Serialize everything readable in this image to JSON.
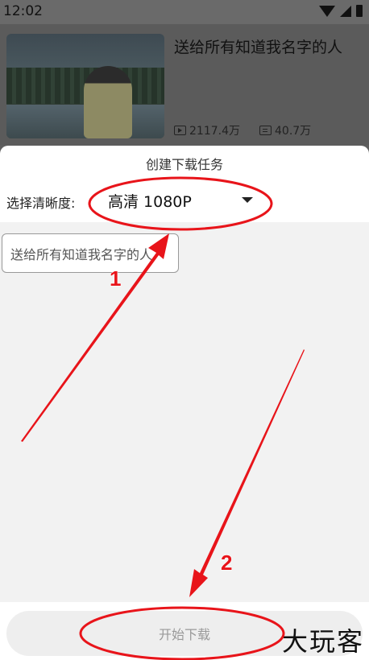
{
  "status_bar": {
    "time": "12:02",
    "icons": [
      "wifi-icon",
      "signal-icon",
      "battery-icon"
    ]
  },
  "background_video": {
    "title": "送给所有知道我名字的人",
    "play_count": "2117.4万",
    "comment_count": "40.7万"
  },
  "sheet": {
    "title": "创建下载任务",
    "quality_label": "选择清晰度:",
    "quality_value": "高清 1080P",
    "filename_value": "送给所有知道我名字的人",
    "download_button": "开始下载"
  },
  "annotations": {
    "step1": "1",
    "step2": "2",
    "color": "#e8141a"
  },
  "watermark": "大玩客"
}
